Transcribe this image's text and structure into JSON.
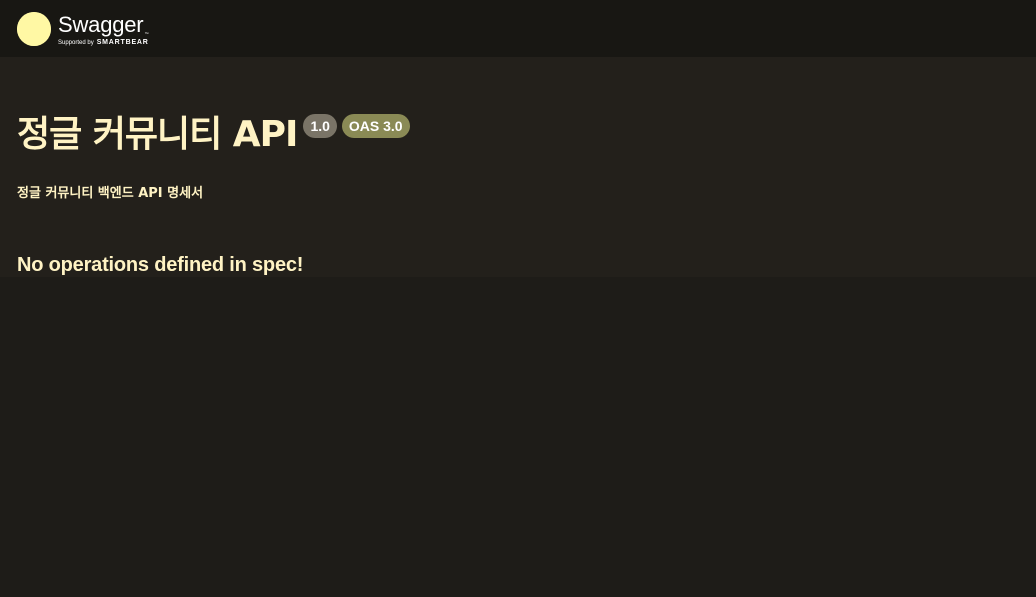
{
  "topbar": {
    "logo_name": "Swagger",
    "logo_tm": "™",
    "logo_supported_by": "Supported by",
    "logo_brand": "SMARTBEAR",
    "logo_icon": "swagger-logo-icon",
    "accent_color": "#fff8a4"
  },
  "info": {
    "title": "정글 커뮤니티 API",
    "version_badge": "1.0",
    "oas_badge": "OAS 3.0",
    "description": "정글 커뮤니티 백엔드 API 명세서"
  },
  "operations": {
    "empty_message": "No operations defined in spec!"
  },
  "colors": {
    "background": "#1e1c18",
    "topbar_bg": "#181713",
    "info_bg": "#23201b",
    "text": "#fff3c4",
    "version_badge_bg": "#7a7467",
    "oas_badge_bg": "#8a8a55"
  }
}
